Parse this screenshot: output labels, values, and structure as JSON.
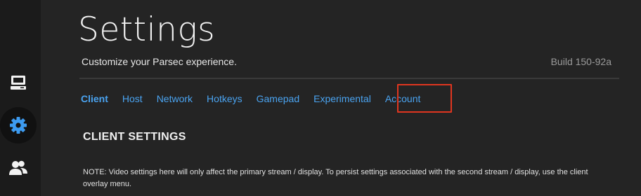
{
  "sidebar": {
    "items": [
      {
        "name": "computers",
        "icon": "computer-icon",
        "active": false
      },
      {
        "name": "settings",
        "icon": "gear-icon",
        "active": true
      },
      {
        "name": "friends",
        "icon": "friends-icon",
        "active": false
      }
    ]
  },
  "header": {
    "title": "Settings",
    "subtitle": "Customize your Parsec experience.",
    "build": "Build 150-92a"
  },
  "tabs": [
    {
      "label": "Client",
      "active": true
    },
    {
      "label": "Host",
      "active": false
    },
    {
      "label": "Network",
      "active": false
    },
    {
      "label": "Hotkeys",
      "active": false
    },
    {
      "label": "Gamepad",
      "active": false
    },
    {
      "label": "Experimental",
      "active": false
    },
    {
      "label": "Account",
      "active": false
    }
  ],
  "section": {
    "title": "CLIENT SETTINGS",
    "note": "NOTE: Video settings here will only affect the primary stream / display. To persist settings associated with the second stream / display, use the client overlay menu."
  },
  "colors": {
    "accent": "#4aa3f0",
    "highlight": "#e0361f",
    "background": "#242424",
    "sidebar": "#1b1b1b"
  }
}
